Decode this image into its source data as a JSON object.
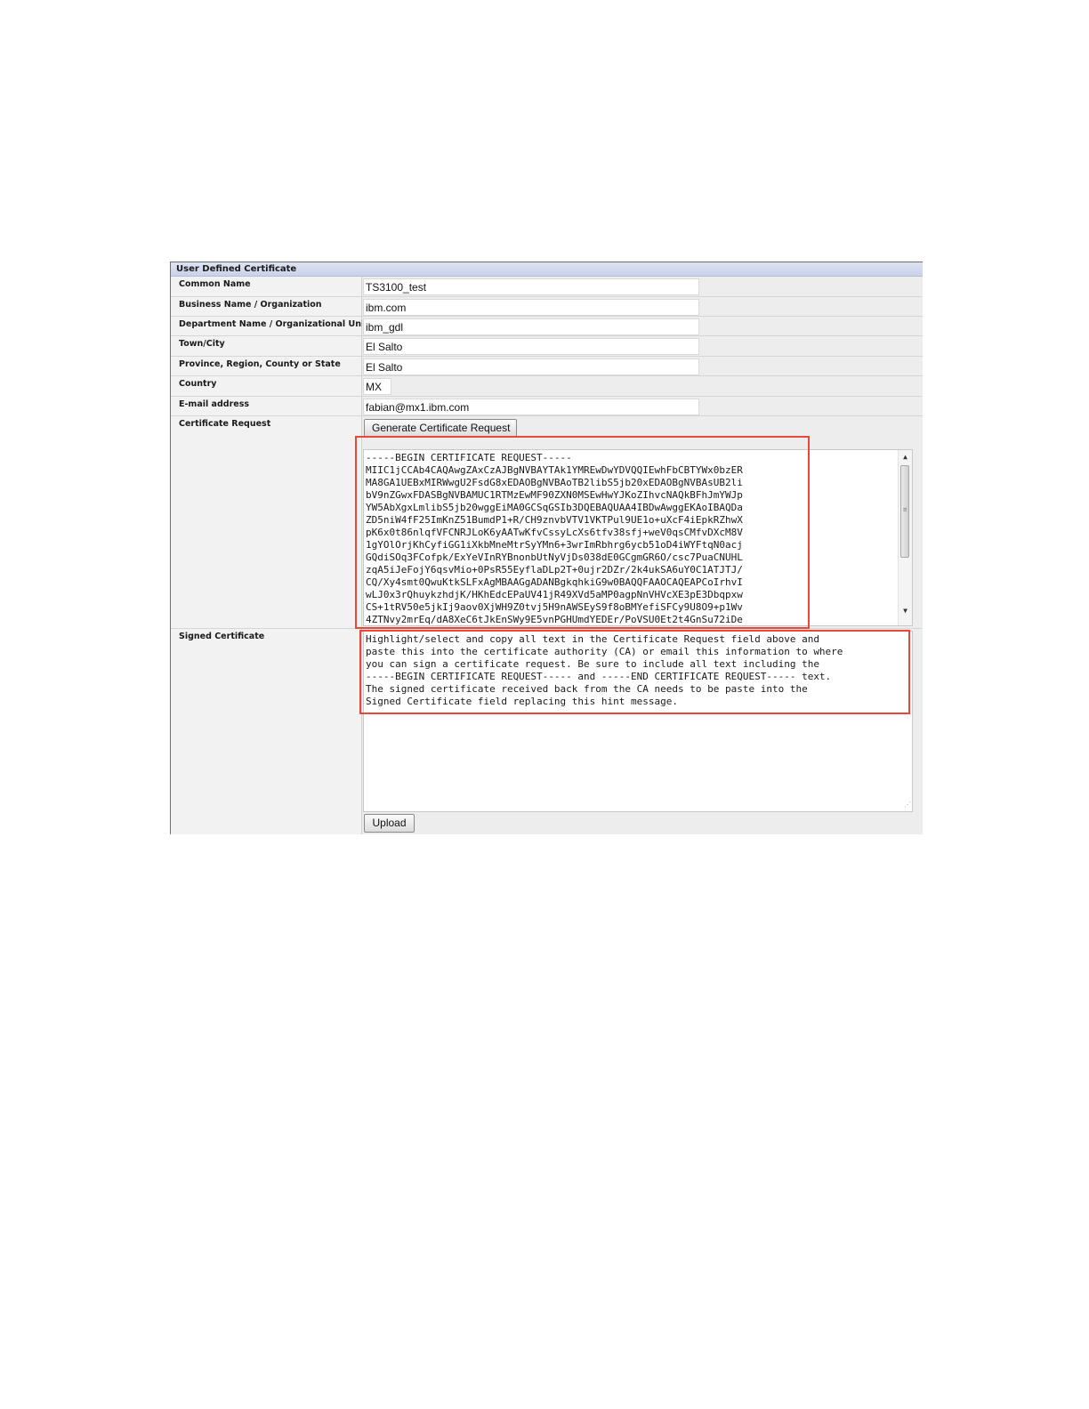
{
  "panel": {
    "title": "User Defined Certificate"
  },
  "fields": {
    "common_name": {
      "label": "Common Name",
      "value": "TS3100_test"
    },
    "business_name": {
      "label": "Business Name / Organization",
      "value": "ibm.com"
    },
    "department_name": {
      "label": "Department Name / Organizational Unit",
      "value": "ibm_gdl"
    },
    "town_city": {
      "label": "Town/City",
      "value": "El Salto"
    },
    "province": {
      "label": "Province, Region, County or State",
      "value": "El Salto"
    },
    "country": {
      "label": "Country",
      "value": "MX"
    },
    "email": {
      "label": "E-mail address",
      "value": "fabian@mx1.ibm.com"
    }
  },
  "certificate_request": {
    "label": "Certificate Request",
    "generate_button": "Generate Certificate Request",
    "text": "-----BEGIN CERTIFICATE REQUEST-----\nMIIC1jCCAb4CAQAwgZAxCzAJBgNVBAYTAk1YMREwDwYDVQQIEwhFbCBTYWx0bzER\nMA8GA1UEBxMIRWwgU2FsdG8xEDAOBgNVBAoTB2libS5jb20xEDAOBgNVBAsUB2li\nbV9nZGwxFDASBgNVBAMUC1RTMzEwMF90ZXN0MSEwHwYJKoZIhvcNAQkBFhJmYWJp\nYW5AbXgxLmlibS5jb20wggEiMA0GCSqGSIb3DQEBAQUAA4IBDwAwggEKAoIBAQDa\nZD5niW4fF25ImKnZ51BumdP1+R/CH9znvbVTV1VKTPul9UE1o+uXcF4iEpkRZhwX\npK6x0t86nlqfVFCNRJLoK6yAATwKfvCssyLcXs6tfv38sfj+weV0qsCMfvDXcM8V\n1gYOlOrjKhCyfiGG1iXkbMneMtrSyYMn6+3wrImRbhrg6ycb51oD4iWYFtqN0acj\nGQdiSOq3FCofpk/ExYeVInRYBnonbUtNyVjDs038dE0GCgmGR6O/csc7PuaCNUHL\nzqA5iJeFojY6qsvMio+0PsR55EyflaDLp2T+0ujr2DZr/2k4ukSA6uY0C1ATJTJ/\nCQ/Xy4smt0QwuKtkSLFxAgMBAAGgADANBgkqhkiG9w0BAQQFAAOCAQEAPCoIrhvI\nwLJ0x3rQhuykzhdjK/HKhEdcEPaUV41jR49XVd5aMP0agpNnVHVcXE3pE3Dbqpxw\nCS+1tRV50e5jkIj9aov0XjWH9Z0tvj5H9nAWSEyS9f8oBMYefiSFCy9U8O9+p1Wv\n4ZTNvy2mrEq/dA8XeC6tJkEnSWy9E5vnPGHUmdYEDEr/PoVSU0Et2t4GnSu72iDe"
  },
  "signed_certificate": {
    "label": "Signed Certificate",
    "hint": "Highlight/select and copy all text in the Certificate Request field above and\npaste this into the certificate authority (CA) or email this information to where\nyou can sign a certificate request. Be sure to include all text including the\n-----BEGIN CERTIFICATE REQUEST----- and -----END CERTIFICATE REQUEST----- text.\nThe signed certificate received back from the CA needs to be paste into the\nSigned Certificate field replacing this hint message.",
    "upload_button": "Upload"
  },
  "colors": {
    "highlight": "#e8473a",
    "header": "#c9d2ea"
  },
  "icons": {
    "scroll_up": "scroll-up-arrow-icon",
    "scroll_down": "scroll-down-arrow-icon",
    "resize": "resize-grip-icon"
  }
}
